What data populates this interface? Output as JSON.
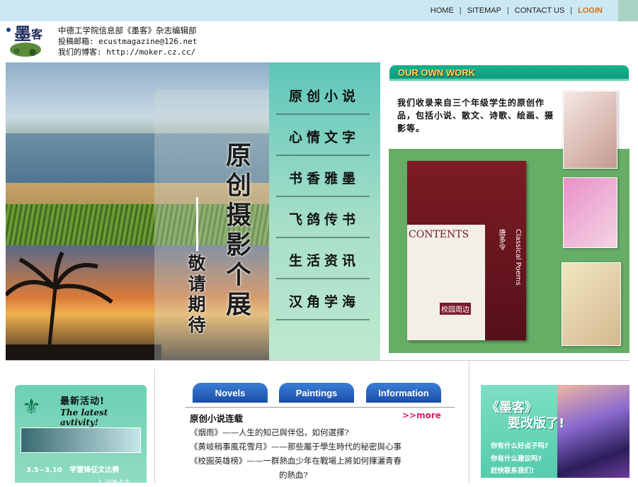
{
  "nav": {
    "home": "HOME",
    "sitemap": "SITEMAP",
    "contact": "CONTACT US",
    "login": "LOGIN"
  },
  "header": {
    "dept": "中德工学院信息部《墨客》杂志编辑部",
    "email_line": "投稿邮箱: ecustmagazine@126.net",
    "blog_line": "我们的博客: http://moker.cz.cc/"
  },
  "hero": {
    "title": "原创摄影个展",
    "subtitle": "敬请期待"
  },
  "menu": {
    "items": [
      "原创小说",
      "心情文字",
      "书香雅墨",
      "飞鸽传书",
      "生活资讯",
      "汉角学海"
    ]
  },
  "own_work": {
    "heading": "OUR OWN WORK",
    "description": "我们收录来自三个年级学生的原创作品，包括小说、散文、诗歌、绘画、摄影等。",
    "magazine_contents": "CONTENTS",
    "magazine_poems": "Classical Poems",
    "magazine_author": "唐多令",
    "magazine_campus": "校园周边"
  },
  "activity": {
    "title_cn": "最新活动!",
    "title_en": "The latest avtivity!",
    "date": "3.5~3.10",
    "event": "学雷锋征文比赛",
    "more": "》详情点击"
  },
  "tabs": [
    "Novels",
    "Paintings",
    "Information"
  ],
  "novels": {
    "section_title": "原创小说连载",
    "more": ">>more",
    "items": [
      "《烟雨》——人生的知己與伴侶，如何選擇?",
      "《黄岐稍事風花雪月》——那些屬于學生時代的秘密與心事",
      "《校園英雄榜》——一群熱血少年在戰場上將如何揮灑青春",
      "的熱血?"
    ]
  },
  "ad": {
    "title1": "《墨客》",
    "title2": "要改版了!",
    "q1": "你有什么好点子吗?",
    "q2": "你有什么建议吗?",
    "q3": "赶快联系我们!"
  }
}
